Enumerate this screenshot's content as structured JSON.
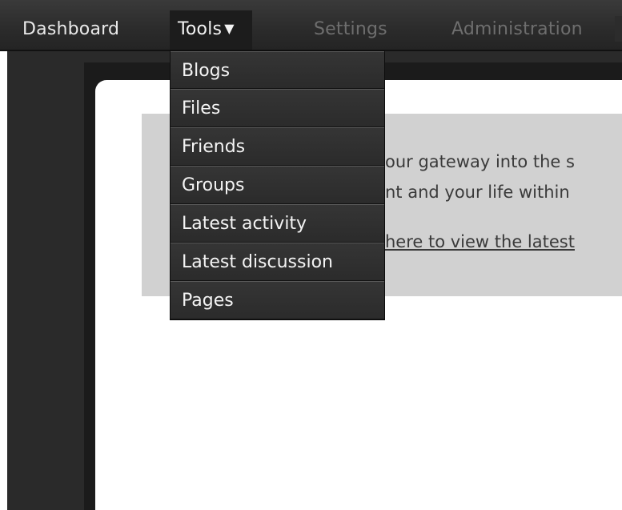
{
  "nav": {
    "dashboard": "Dashboard",
    "tools": "Tools",
    "tools_caret": "▼",
    "settings": "Settings",
    "administration": "Administration"
  },
  "tools_menu": {
    "items": [
      {
        "label": "Blogs"
      },
      {
        "label": "Files"
      },
      {
        "label": "Friends"
      },
      {
        "label": "Groups"
      },
      {
        "label": "Latest activity"
      },
      {
        "label": "Latest discussion"
      },
      {
        "label": "Pages"
      }
    ]
  },
  "welcome": {
    "line1": "our gateway into the s",
    "line2": "nt and your life within",
    "link": "here to view the latest"
  },
  "colors": {
    "nav_bg": "#2b2b2b",
    "nav_active_bg": "#1c1c1c",
    "nav_disabled_text": "#6e6e6e",
    "menu_bg": "#2e2e2e",
    "panel_bg": "#d1d1d1"
  }
}
